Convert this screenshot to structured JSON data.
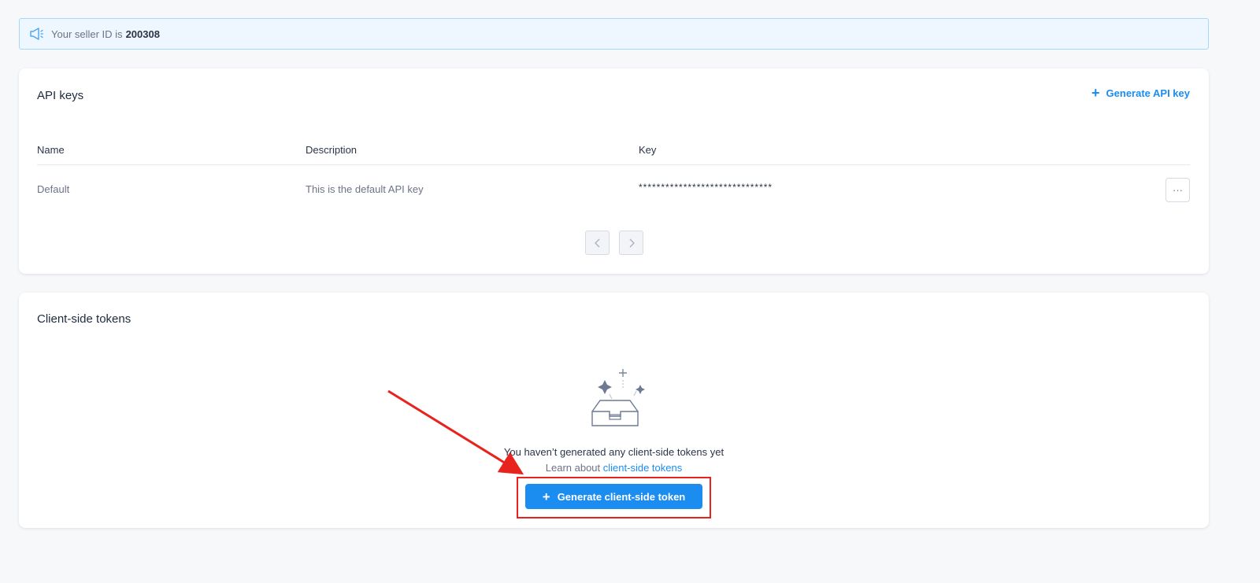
{
  "notice": {
    "prefix": "Your seller ID is",
    "seller_id": "200308",
    "icon": "megaphone-icon"
  },
  "api_keys": {
    "title": "API keys",
    "generate_label": "Generate API key",
    "columns": [
      "Name",
      "Description",
      "Key"
    ],
    "rows": [
      {
        "name": "Default",
        "description": "This is the default API key",
        "key": "******************************"
      }
    ],
    "more_label": "···"
  },
  "client_tokens": {
    "title": "Client-side tokens",
    "empty_message": "You haven’t generated any client-side tokens yet",
    "learn_prefix": "Learn about",
    "learn_link": "client-side tokens",
    "generate_label": "Generate client-side token"
  },
  "colors": {
    "accent": "#1b8cf0",
    "annotation": "#e8231d"
  }
}
